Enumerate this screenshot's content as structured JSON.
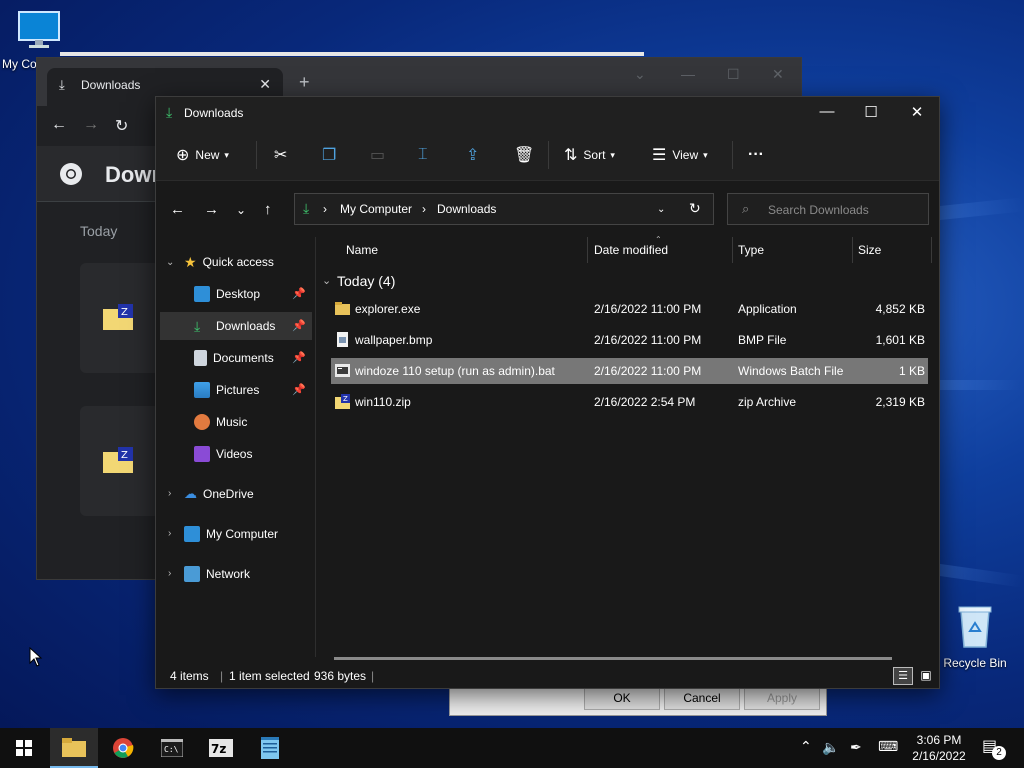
{
  "desktop": {
    "my_computer_label": "My Co",
    "recycle_bin_label": "Recycle Bin"
  },
  "chrome": {
    "tab_title": "Downloads",
    "header_title": "Down",
    "section_today": "Today"
  },
  "dialog": {
    "ok": "OK",
    "cancel": "Cancel",
    "apply": "Apply"
  },
  "explorer": {
    "title": "Downloads",
    "toolbar": {
      "new": "New",
      "sort": "Sort",
      "view": "View",
      "more": "···"
    },
    "address": {
      "segments": [
        "My Computer",
        "Downloads"
      ]
    },
    "search_placeholder": "Search Downloads",
    "nav": {
      "quick_access": "Quick access",
      "desktop": "Desktop",
      "downloads": "Downloads",
      "documents": "Documents",
      "pictures": "Pictures",
      "music": "Music",
      "videos": "Videos",
      "onedrive": "OneDrive",
      "my_computer": "My Computer",
      "network": "Network"
    },
    "columns": {
      "name": "Name",
      "date": "Date modified",
      "type": "Type",
      "size": "Size"
    },
    "group_label": "Today (4)",
    "files": [
      {
        "name": "explorer.exe",
        "date": "2/16/2022 11:00 PM",
        "type": "Application",
        "size": "4,852 KB"
      },
      {
        "name": "wallpaper.bmp",
        "date": "2/16/2022 11:00 PM",
        "type": "BMP File",
        "size": "1,601 KB"
      },
      {
        "name": "windoze 110 setup (run as admin).bat",
        "date": "2/16/2022 11:00 PM",
        "type": "Windows Batch File",
        "size": "1 KB"
      },
      {
        "name": "win110.zip",
        "date": "2/16/2022 2:54 PM",
        "type": "zip Archive",
        "size": "2,319 KB"
      }
    ],
    "status": {
      "items": "4 items",
      "selected": "1 item selected",
      "bytes": "936 bytes"
    }
  },
  "taskbar": {
    "time": "3:06 PM",
    "date": "2/16/2022",
    "notification_count": "2"
  },
  "colors": {
    "selection": "#777777",
    "accent": "#76b9ed",
    "folder": "#e8c25a"
  }
}
